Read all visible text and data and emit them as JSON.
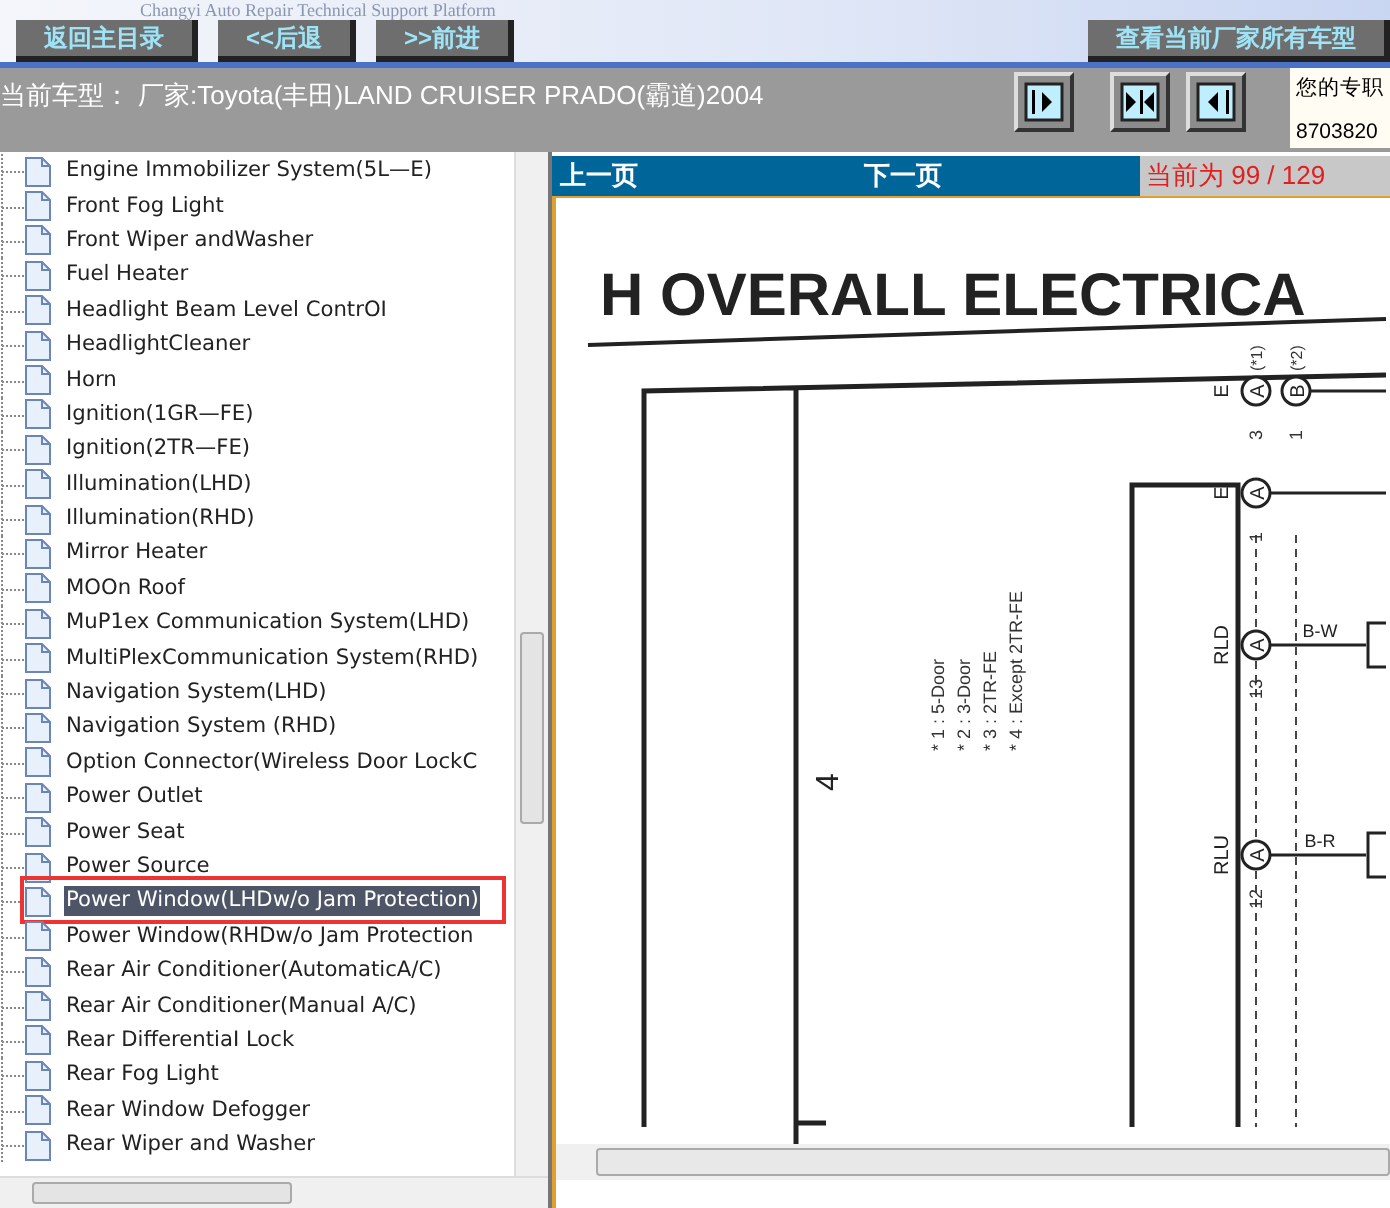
{
  "banner": {
    "subtitle": "Changyi Auto Repair Technical Support Platform",
    "buttons": [
      "返回主目录",
      "<<后退",
      ">>前进",
      "查看当前厂家所有车型"
    ]
  },
  "model_bar": {
    "label": "当前车型：",
    "model": "厂家:Toyota(丰田)LAND CRUISER PRADO(霸道)2004",
    "info_lines": [
      "您的专职",
      "8703820"
    ]
  },
  "tree": {
    "items": [
      {
        "label": "Engine Immobilizer System(5L—E)",
        "selected": false,
        "highlighted": false
      },
      {
        "label": "Front Fog Light",
        "selected": false,
        "highlighted": false
      },
      {
        "label": "Front Wiper andWasher",
        "selected": false,
        "highlighted": false
      },
      {
        "label": "Fuel Heater",
        "selected": false,
        "highlighted": false
      },
      {
        "label": "Headlight Beam Level ContrOI",
        "selected": false,
        "highlighted": false
      },
      {
        "label": "HeadlightCleaner",
        "selected": false,
        "highlighted": false
      },
      {
        "label": "Horn",
        "selected": false,
        "highlighted": false
      },
      {
        "label": "Ignition(1GR—FE)",
        "selected": false,
        "highlighted": false
      },
      {
        "label": "Ignition(2TR—FE)",
        "selected": false,
        "highlighted": false
      },
      {
        "label": "Illumination(LHD)",
        "selected": false,
        "highlighted": false
      },
      {
        "label": "Illumination(RHD)",
        "selected": false,
        "highlighted": false
      },
      {
        "label": "Mirror Heater",
        "selected": false,
        "highlighted": false
      },
      {
        "label": "MOOn Roof",
        "selected": false,
        "highlighted": false
      },
      {
        "label": "MuP1ex Communication System(LHD)",
        "selected": false,
        "highlighted": false
      },
      {
        "label": "MuItiPlexCommunication System(RHD)",
        "selected": false,
        "highlighted": false
      },
      {
        "label": "Navigation System(LHD)",
        "selected": false,
        "highlighted": false
      },
      {
        "label": "Navigation System (RHD)",
        "selected": false,
        "highlighted": false
      },
      {
        "label": "Option Connector(Wireless Door LockC",
        "selected": false,
        "highlighted": false
      },
      {
        "label": "Power Outlet",
        "selected": false,
        "highlighted": false
      },
      {
        "label": "Power Seat",
        "selected": false,
        "highlighted": false
      },
      {
        "label": "Power Source",
        "selected": false,
        "highlighted": false
      },
      {
        "label": "Power Window(LHDw/o Jam Protection)",
        "selected": true,
        "highlighted": true
      },
      {
        "label": "Power Window(RHDw/o Jam Protection",
        "selected": false,
        "highlighted": false
      },
      {
        "label": "Rear Air Conditioner(AutomaticA/C)",
        "selected": false,
        "highlighted": false
      },
      {
        "label": "Rear Air Conditioner(Manual A/C)",
        "selected": false,
        "highlighted": false
      },
      {
        "label": "Rear DifferentiaI Lock",
        "selected": false,
        "highlighted": false
      },
      {
        "label": "Rear Fog Light",
        "selected": false,
        "highlighted": false
      },
      {
        "label": "Rear Window Defogger",
        "selected": false,
        "highlighted": false
      },
      {
        "label": "Rear Wiper and Washer",
        "selected": false,
        "highlighted": false
      }
    ]
  },
  "viewer": {
    "prev": "上一页",
    "next": "下一页",
    "page_status": "当前为 99 / 129",
    "document": {
      "title": "H  OVERALL ELECTRICA",
      "section": "4",
      "notes": [
        "* 1 : 5-Door",
        "* 2 : 3-Door",
        "* 3 : 2TR-FE",
        "* 4 : Except 2TR-FE"
      ],
      "connectors": [
        {
          "letter": "A",
          "pin": "3",
          "label": "E",
          "note": "(*1)"
        },
        {
          "letter": "B",
          "pin": "1",
          "note": "(*2)"
        },
        {
          "letter": "A",
          "pin": "1",
          "label": "E"
        },
        {
          "letter": "A",
          "pin": "13",
          "label": "RLD",
          "wire": "B-W"
        },
        {
          "letter": "A",
          "pin": "12",
          "label": "RLU",
          "wire": "B-R"
        }
      ]
    }
  }
}
